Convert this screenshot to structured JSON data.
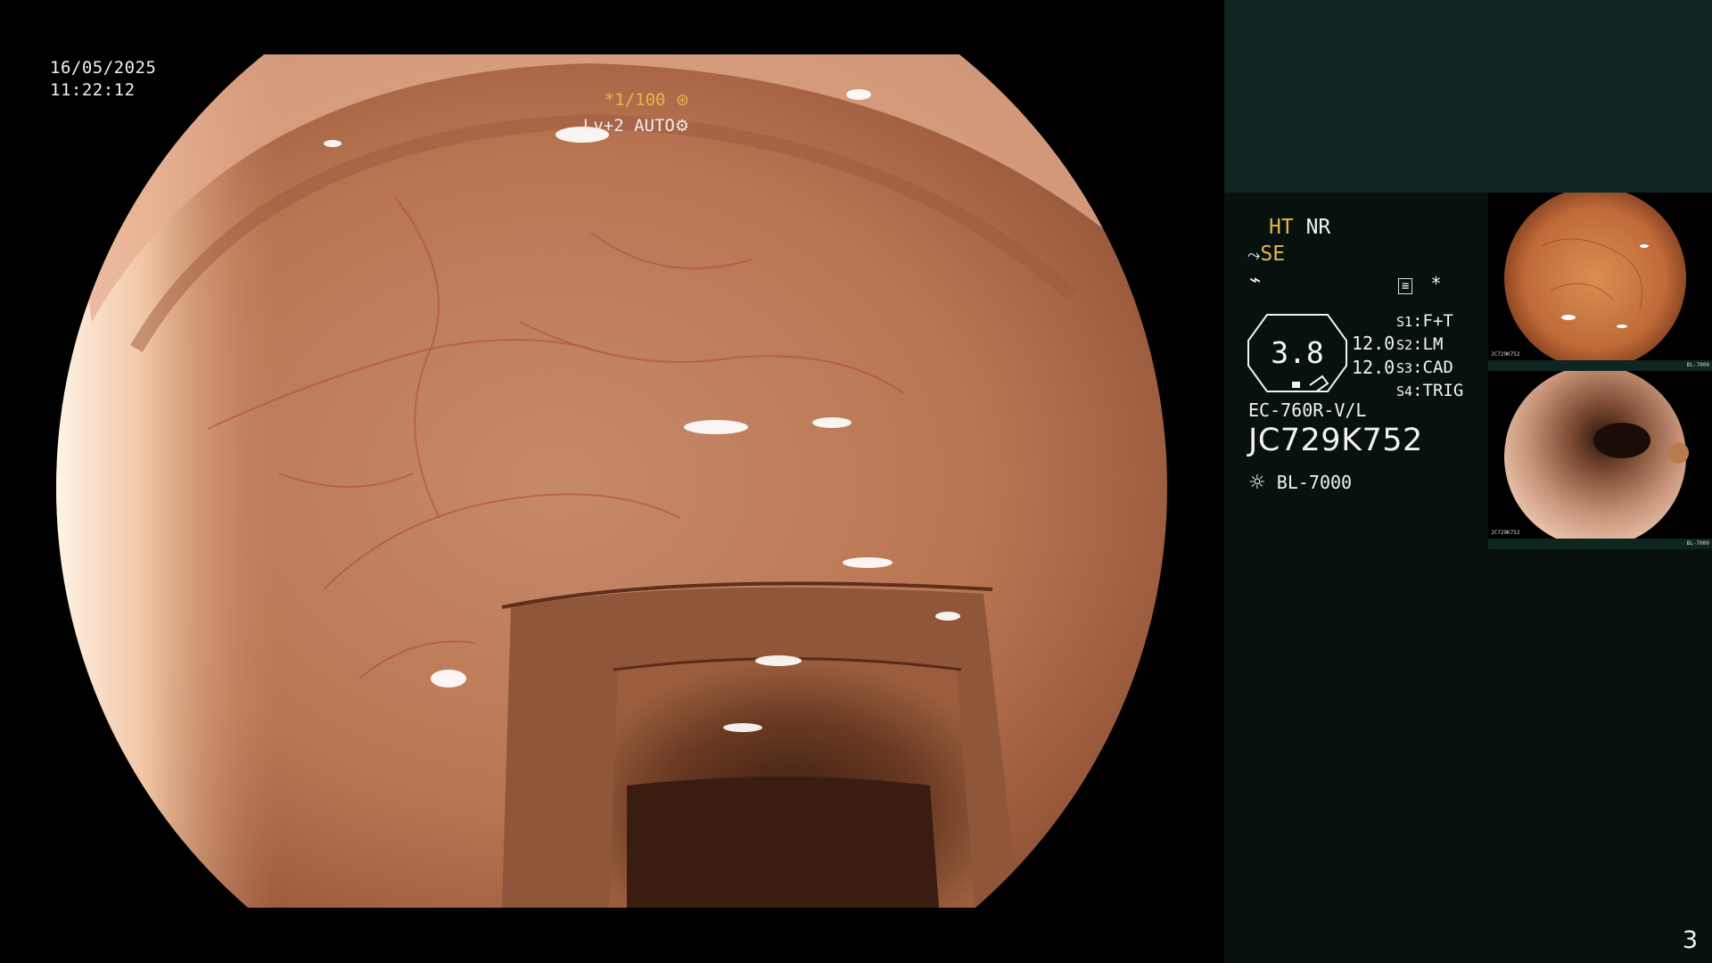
{
  "overlay": {
    "date": "16/05/2025",
    "time": "11:22:12",
    "shutter": "*1/100",
    "level": "Lv+2",
    "mode": "AUTO"
  },
  "panel": {
    "ht": "HT",
    "nr": "NR",
    "se": "SE",
    "scope_value": "3.8",
    "val1": "12.0",
    "val2": "12.0",
    "switches": [
      {
        "key": "S1",
        "value": "F+T"
      },
      {
        "key": "S2",
        "value": "LM"
      },
      {
        "key": "S3",
        "value": "CAD"
      },
      {
        "key": "S4",
        "value": "TRIG"
      }
    ],
    "scope_model": "EC-760R-V/L",
    "serial": "JC729K752",
    "light_source": "BL-7000",
    "asterisk": "*"
  },
  "thumbnails": [
    {
      "serial": "JC729K752",
      "light": "BL-7000"
    },
    {
      "serial": "JC729K752",
      "light": "BL-7000"
    }
  ],
  "page_number": "3",
  "icons": [
    "aperture-icon",
    "gear-icon",
    "scope-tip-icon",
    "lightning-icon",
    "menu-icon",
    "lamp-icon"
  ],
  "colors": {
    "amber": "#e6b64a",
    "panel": "#07120f",
    "panel_top": "#0e2522",
    "mucosa": "#c98a66"
  }
}
